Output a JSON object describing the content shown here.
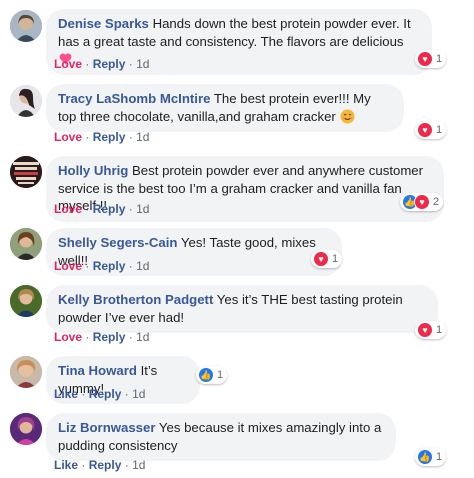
{
  "comments": [
    {
      "name": "Denise Sparks",
      "text": "Hands down the best protein powder ever. It has a great taste and consistency. The flavors are delicious",
      "emoji": "heart-emoji",
      "action": "Love",
      "reply": "Reply",
      "time": "1d",
      "reactions": [
        "heart-icon"
      ],
      "count": "1",
      "avatar_color": "#7a8fa6"
    },
    {
      "name": "Tracy LaShomb McIntire",
      "text": "The best protein ever!!! My top three chocolate, vanilla,and graham cracker",
      "emoji": "smile-emoji",
      "action": "Love",
      "reply": "Reply",
      "time": "1d",
      "reactions": [
        "heart-icon"
      ],
      "count": "1",
      "avatar_color": "#c8c8d0"
    },
    {
      "name": "Holly Uhrig",
      "text": "Best protein powder ever and anywhere customer service is the best too I’m a graham cracker and vanilla fan myself !!",
      "emoji": "",
      "action": "Love",
      "reply": "Reply",
      "time": "1d",
      "reactions": [
        "thumb-icon",
        "heart-icon"
      ],
      "count": "2",
      "avatar_color": "#4a2b2b"
    },
    {
      "name": "Shelly Segers-Cain",
      "text": "Yes! Taste good, mixes well!!",
      "emoji": "",
      "action": "Love",
      "reply": "Reply",
      "time": "1d",
      "reactions": [
        "heart-icon"
      ],
      "count": "1",
      "avatar_color": "#8a6a4a"
    },
    {
      "name": "Kelly Brotherton Padgett",
      "text": "Yes it’s THE best tasting protein powder I’ve ever had!",
      "emoji": "",
      "action": "Love",
      "reply": "Reply",
      "time": "1d",
      "reactions": [
        "heart-icon"
      ],
      "count": "1",
      "avatar_color": "#5a7a3a"
    },
    {
      "name": "Tina Howard",
      "text": "It’s yummy!",
      "emoji": "",
      "action": "Like",
      "reply": "Reply",
      "time": "1d",
      "reactions": [
        "thumb-icon"
      ],
      "count": "1",
      "avatar_color": "#b08a70"
    },
    {
      "name": "Liz Bornwasser",
      "text": "Yes because it mixes amazingly into a pudding consistency",
      "emoji": "",
      "action": "Like",
      "reply": "Reply",
      "time": "1d",
      "reactions": [
        "thumb-icon"
      ],
      "count": "1",
      "avatar_color": "#6a3a8a"
    }
  ],
  "colors": {
    "name": "#385898",
    "love": "#e0245e",
    "like": "#385898",
    "bubble": "#f2f3f5",
    "heart": "#f0284a",
    "thumb": "#2078f4"
  }
}
